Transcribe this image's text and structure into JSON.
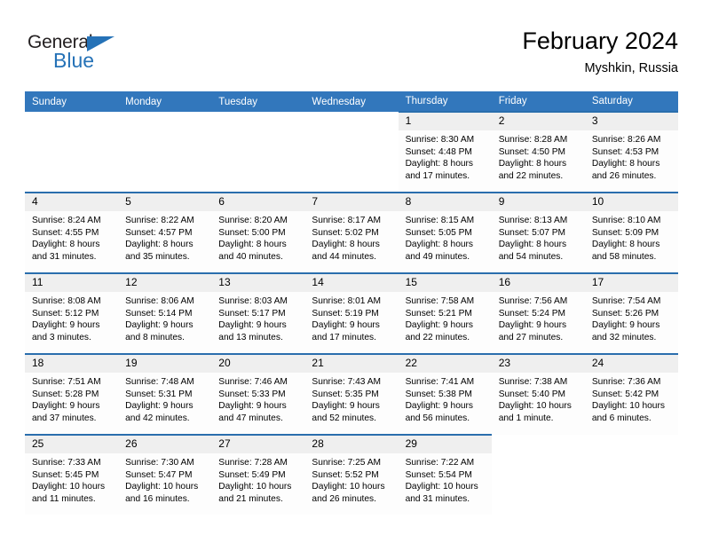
{
  "brand": {
    "name_top": "General",
    "name_bottom": "Blue",
    "triangle_icon": "triangle-icon",
    "color_top": "#231f20",
    "color_bottom": "#2572b7"
  },
  "header": {
    "title": "February 2024",
    "subtitle": "Myshkin, Russia"
  },
  "theme": {
    "header_bg": "#3277bc",
    "cell_top_border": "#2a6ead",
    "daynum_bg": "#efefef",
    "cell_bg": "#fdfdfd"
  },
  "weekday_headers": [
    "Sunday",
    "Monday",
    "Tuesday",
    "Wednesday",
    "Thursday",
    "Friday",
    "Saturday"
  ],
  "weeks": [
    [
      {
        "day": "",
        "lines": [],
        "empty": true
      },
      {
        "day": "",
        "lines": [],
        "empty": true
      },
      {
        "day": "",
        "lines": [],
        "empty": true
      },
      {
        "day": "",
        "lines": [],
        "empty": true
      },
      {
        "day": "1",
        "lines": [
          "Sunrise: 8:30 AM",
          "Sunset: 4:48 PM",
          "Daylight: 8 hours",
          "and 17 minutes."
        ],
        "empty": false
      },
      {
        "day": "2",
        "lines": [
          "Sunrise: 8:28 AM",
          "Sunset: 4:50 PM",
          "Daylight: 8 hours",
          "and 22 minutes."
        ],
        "empty": false
      },
      {
        "day": "3",
        "lines": [
          "Sunrise: 8:26 AM",
          "Sunset: 4:53 PM",
          "Daylight: 8 hours",
          "and 26 minutes."
        ],
        "empty": false
      }
    ],
    [
      {
        "day": "4",
        "lines": [
          "Sunrise: 8:24 AM",
          "Sunset: 4:55 PM",
          "Daylight: 8 hours",
          "and 31 minutes."
        ],
        "empty": false
      },
      {
        "day": "5",
        "lines": [
          "Sunrise: 8:22 AM",
          "Sunset: 4:57 PM",
          "Daylight: 8 hours",
          "and 35 minutes."
        ],
        "empty": false
      },
      {
        "day": "6",
        "lines": [
          "Sunrise: 8:20 AM",
          "Sunset: 5:00 PM",
          "Daylight: 8 hours",
          "and 40 minutes."
        ],
        "empty": false
      },
      {
        "day": "7",
        "lines": [
          "Sunrise: 8:17 AM",
          "Sunset: 5:02 PM",
          "Daylight: 8 hours",
          "and 44 minutes."
        ],
        "empty": false
      },
      {
        "day": "8",
        "lines": [
          "Sunrise: 8:15 AM",
          "Sunset: 5:05 PM",
          "Daylight: 8 hours",
          "and 49 minutes."
        ],
        "empty": false
      },
      {
        "day": "9",
        "lines": [
          "Sunrise: 8:13 AM",
          "Sunset: 5:07 PM",
          "Daylight: 8 hours",
          "and 54 minutes."
        ],
        "empty": false
      },
      {
        "day": "10",
        "lines": [
          "Sunrise: 8:10 AM",
          "Sunset: 5:09 PM",
          "Daylight: 8 hours",
          "and 58 minutes."
        ],
        "empty": false
      }
    ],
    [
      {
        "day": "11",
        "lines": [
          "Sunrise: 8:08 AM",
          "Sunset: 5:12 PM",
          "Daylight: 9 hours",
          "and 3 minutes."
        ],
        "empty": false
      },
      {
        "day": "12",
        "lines": [
          "Sunrise: 8:06 AM",
          "Sunset: 5:14 PM",
          "Daylight: 9 hours",
          "and 8 minutes."
        ],
        "empty": false
      },
      {
        "day": "13",
        "lines": [
          "Sunrise: 8:03 AM",
          "Sunset: 5:17 PM",
          "Daylight: 9 hours",
          "and 13 minutes."
        ],
        "empty": false
      },
      {
        "day": "14",
        "lines": [
          "Sunrise: 8:01 AM",
          "Sunset: 5:19 PM",
          "Daylight: 9 hours",
          "and 17 minutes."
        ],
        "empty": false
      },
      {
        "day": "15",
        "lines": [
          "Sunrise: 7:58 AM",
          "Sunset: 5:21 PM",
          "Daylight: 9 hours",
          "and 22 minutes."
        ],
        "empty": false
      },
      {
        "day": "16",
        "lines": [
          "Sunrise: 7:56 AM",
          "Sunset: 5:24 PM",
          "Daylight: 9 hours",
          "and 27 minutes."
        ],
        "empty": false
      },
      {
        "day": "17",
        "lines": [
          "Sunrise: 7:54 AM",
          "Sunset: 5:26 PM",
          "Daylight: 9 hours",
          "and 32 minutes."
        ],
        "empty": false
      }
    ],
    [
      {
        "day": "18",
        "lines": [
          "Sunrise: 7:51 AM",
          "Sunset: 5:28 PM",
          "Daylight: 9 hours",
          "and 37 minutes."
        ],
        "empty": false
      },
      {
        "day": "19",
        "lines": [
          "Sunrise: 7:48 AM",
          "Sunset: 5:31 PM",
          "Daylight: 9 hours",
          "and 42 minutes."
        ],
        "empty": false
      },
      {
        "day": "20",
        "lines": [
          "Sunrise: 7:46 AM",
          "Sunset: 5:33 PM",
          "Daylight: 9 hours",
          "and 47 minutes."
        ],
        "empty": false
      },
      {
        "day": "21",
        "lines": [
          "Sunrise: 7:43 AM",
          "Sunset: 5:35 PM",
          "Daylight: 9 hours",
          "and 52 minutes."
        ],
        "empty": false
      },
      {
        "day": "22",
        "lines": [
          "Sunrise: 7:41 AM",
          "Sunset: 5:38 PM",
          "Daylight: 9 hours",
          "and 56 minutes."
        ],
        "empty": false
      },
      {
        "day": "23",
        "lines": [
          "Sunrise: 7:38 AM",
          "Sunset: 5:40 PM",
          "Daylight: 10 hours",
          "and 1 minute."
        ],
        "empty": false
      },
      {
        "day": "24",
        "lines": [
          "Sunrise: 7:36 AM",
          "Sunset: 5:42 PM",
          "Daylight: 10 hours",
          "and 6 minutes."
        ],
        "empty": false
      }
    ],
    [
      {
        "day": "25",
        "lines": [
          "Sunrise: 7:33 AM",
          "Sunset: 5:45 PM",
          "Daylight: 10 hours",
          "and 11 minutes."
        ],
        "empty": false
      },
      {
        "day": "26",
        "lines": [
          "Sunrise: 7:30 AM",
          "Sunset: 5:47 PM",
          "Daylight: 10 hours",
          "and 16 minutes."
        ],
        "empty": false
      },
      {
        "day": "27",
        "lines": [
          "Sunrise: 7:28 AM",
          "Sunset: 5:49 PM",
          "Daylight: 10 hours",
          "and 21 minutes."
        ],
        "empty": false
      },
      {
        "day": "28",
        "lines": [
          "Sunrise: 7:25 AM",
          "Sunset: 5:52 PM",
          "Daylight: 10 hours",
          "and 26 minutes."
        ],
        "empty": false
      },
      {
        "day": "29",
        "lines": [
          "Sunrise: 7:22 AM",
          "Sunset: 5:54 PM",
          "Daylight: 10 hours",
          "and 31 minutes."
        ],
        "empty": false
      },
      {
        "day": "",
        "lines": [],
        "empty": true
      },
      {
        "day": "",
        "lines": [],
        "empty": true
      }
    ]
  ]
}
